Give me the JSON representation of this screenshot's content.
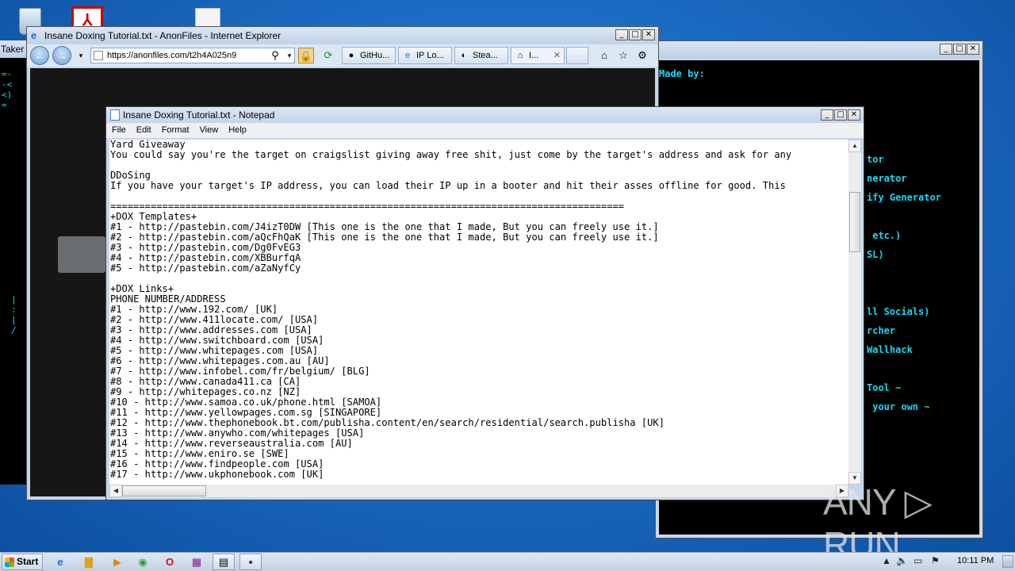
{
  "desktop": {
    "icons": [
      "recycle-bin-icon",
      "pdf-icon",
      "text-file-icon"
    ]
  },
  "left_console": {
    "title": "Taker"
  },
  "console": {
    "lines": [
      "Made by:",
      "tor",
      "nerator",
      "ify Generator",
      " etc.)",
      "SL)",
      "ll Socials)",
      "rcher",
      "Wallhack",
      "Tool ~",
      " your own ~"
    ]
  },
  "ie": {
    "title": "Insane Doxing Tutorial.txt - AnonFiles - Internet Explorer",
    "address": "https://anonfiles.com/t2h4A025n9",
    "tabs": [
      "GitHu...",
      "IP Lo...",
      "Stea...",
      "I..."
    ]
  },
  "notepad": {
    "title": "Insane Doxing Tutorial.txt - Notepad",
    "menu": [
      "File",
      "Edit",
      "Format",
      "View",
      "Help"
    ],
    "lines": [
      "Yard Giveaway",
      "You could say you're the target on craigslist giving away free shit, just come by the target's address and ask for any",
      "",
      "DDoSing",
      "If you have your target's IP address, you can load their IP up in a booter and hit their asses offline for good. This",
      "",
      "=========================================================================================",
      "+DOX Templates+",
      "#1 - http://pastebin.com/J4izT0DW [This one is the one that I made, But you can freely use it.]",
      "#2 - http://pastebin.com/aQcFhQaK [This one is the one that I made, But you can freely use it.]",
      "#3 - http://pastebin.com/Dg0FvEG3",
      "#4 - http://pastebin.com/XBBurfqA",
      "#5 - http://pastebin.com/aZaNyfCy",
      "",
      "+DOX Links+",
      "PHONE NUMBER/ADDRESS",
      "#1 - http://www.192.com/ [UK]",
      "#2 - http://www.411locate.com/ [USA]",
      "#3 - http://www.addresses.com [USA]",
      "#4 - http://www.switchboard.com [USA]",
      "#5 - http://www.whitepages.com [USA]",
      "#6 - http://www.whitepages.com.au [AU]",
      "#7 - http://www.infobel.com/fr/belgium/ [BLG]",
      "#8 - http://www.canada411.ca [CA]",
      "#9 - http://whitepages.co.nz [NZ]",
      "#10 - http://www.samoa.co.uk/phone.html [SAMOA]",
      "#11 - http://www.yellowpages.com.sg [SINGAPORE]",
      "#12 - http://www.thephonebook.bt.com/publisha.content/en/search/residential/search.publisha [UK]",
      "#13 - http://www.anywho.com/whitepages [USA]",
      "#14 - http://www.reverseaustralia.com [AU]",
      "#15 - http://www.eniro.se [SWE]",
      "#16 - http://www.findpeople.com [USA]",
      "#17 - http://www.ukphonebook.com [UK]"
    ]
  },
  "watermark": "ANY ▷ RUN",
  "taskbar": {
    "start_label": "Start",
    "clock": "10:11 PM",
    "buttons": [
      "ie-icon",
      "explorer-icon",
      "media-player-icon",
      "chrome-icon",
      "opera-icon",
      "winrar-icon",
      "notepad-icon",
      "cmd-icon"
    ]
  }
}
